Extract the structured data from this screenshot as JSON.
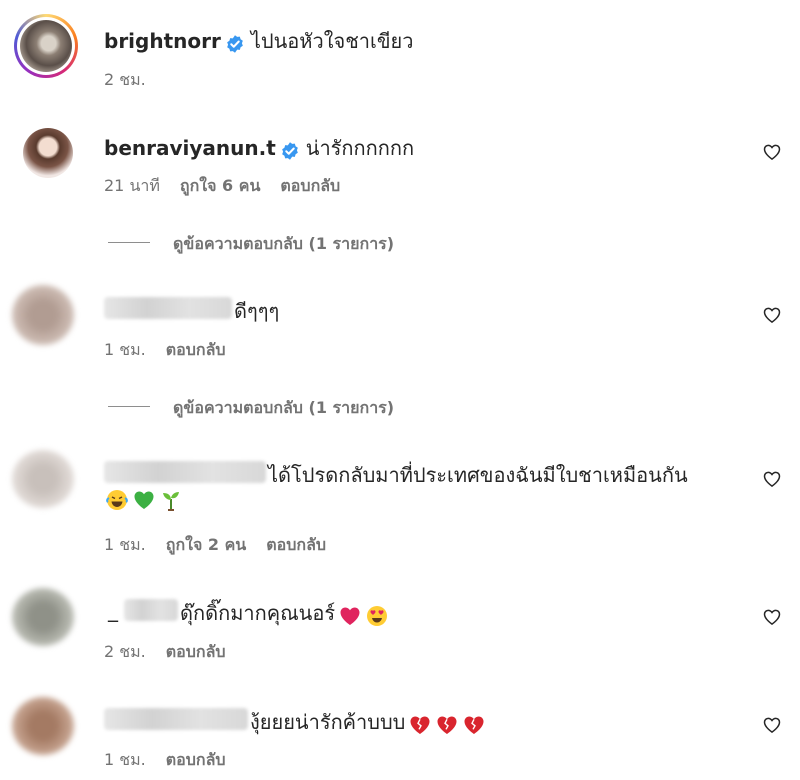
{
  "post": {
    "username": "brightnorr",
    "caption": "ไปนอหัวใจชาเขียว",
    "time": "2 ชม."
  },
  "comments": [
    {
      "username": "benraviyanun.t",
      "text": "น่ารักกกกกก",
      "time": "21 นาที",
      "likes": "ถูกใจ 6 คน",
      "reply": "ตอบกลับ",
      "view_replies": "ดูข้อความตอบกลับ (1 รายการ)"
    },
    {
      "text": "ดีๆๆๆ",
      "time": "1 ชม.",
      "reply": "ตอบกลับ",
      "view_replies": "ดูข้อความตอบกลับ (1 รายการ)"
    },
    {
      "text": "ได้โปรดกลับมาที่ประเทศของฉันมีใบชาเหมือนกัน",
      "emojis": [
        "laughing-tears-emoji",
        "green-heart-emoji",
        "seedling-emoji"
      ],
      "time": "1 ชม.",
      "likes": "ถูกใจ 2 คน",
      "reply": "ตอบกลับ"
    },
    {
      "username_prefix": "_",
      "text": "ดุ๊กดิ๊กมากคุณนอร์",
      "emojis": [
        "red-heart-emoji",
        "heart-eyes-emoji"
      ],
      "time": "2 ชม.",
      "reply": "ตอบกลับ"
    },
    {
      "text": "งุ้ยยยน่ารักค้าบบบ",
      "emojis": [
        "broken-heart-emoji",
        "broken-heart-emoji",
        "broken-heart-emoji"
      ],
      "time": "1 ชม.",
      "reply": "ตอบกลับ"
    }
  ],
  "colors": {
    "verified": "#3897f0",
    "muted": "#737373",
    "text": "#262626"
  }
}
